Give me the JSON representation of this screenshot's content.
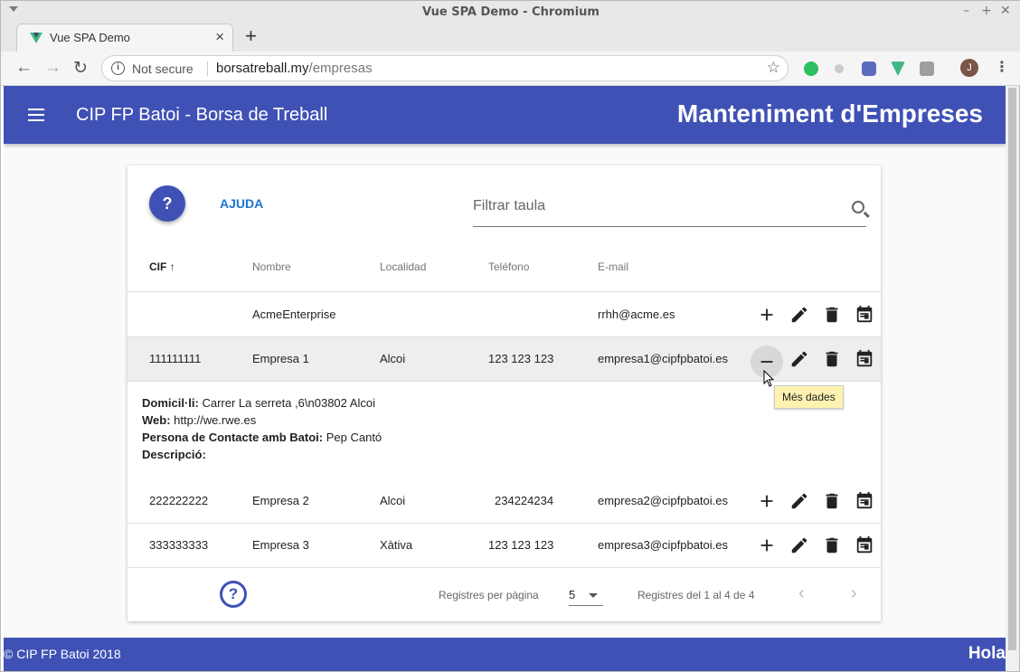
{
  "window": {
    "title": "Vue SPA Demo - Chromium"
  },
  "browser": {
    "tab_label": "Vue SPA Demo",
    "security_label": "Not secure",
    "url_host": "borsatreball.my",
    "url_path": "/empresas"
  },
  "app": {
    "title": "CIP FP Batoi - Borsa de Treball",
    "page_title": "Manteniment d'Empreses",
    "help_fab": "?",
    "help_label": "AJUDA",
    "filter_placeholder": "Filtrar taula",
    "columns": [
      "CIF",
      "Nombre",
      "Localidad",
      "Teléfono",
      "E-mail"
    ],
    "rows": [
      {
        "cif": "",
        "nombre": "AcmeEnterprise",
        "localidad": "",
        "telefono": "",
        "email": "rrhh@acme.es"
      },
      {
        "cif": "111111111",
        "nombre": "Empresa 1",
        "localidad": "Alcoi",
        "telefono": "123 123 123",
        "email": "empresa1@cipfpbatoi.es"
      },
      {
        "cif": "222222222",
        "nombre": "Empresa 2",
        "localidad": "Alcoi",
        "telefono": "234224234",
        "email": "empresa2@cipfpbatoi.es"
      },
      {
        "cif": "333333333",
        "nombre": "Empresa 3",
        "localidad": "Xàtiva",
        "telefono": "123 123 123",
        "email": "empresa3@cipfpbatoi.es"
      }
    ],
    "details": {
      "domicili_label": "Domicil·li:",
      "domicili": "Carrer La serreta ,6\\n03802 Alcoi",
      "web_label": "Web:",
      "web": "http://we.rwe.es",
      "contacte_label": "Persona de Contacte amb Batoi:",
      "contacte": "Pep Cantó",
      "descripcio_label": "Descripció:"
    },
    "tooltip": "Més dades",
    "pagination": {
      "rows_per_page_label": "Registres per pàgina",
      "rows_per_page": "5",
      "range": "Registres del 1 al 4 de 4"
    },
    "footer": {
      "copyright": "© CIP FP Batoi 2018",
      "greeting": "Hola"
    },
    "colors": {
      "primary": "#3f51b5",
      "accent": "#1976d2"
    }
  }
}
